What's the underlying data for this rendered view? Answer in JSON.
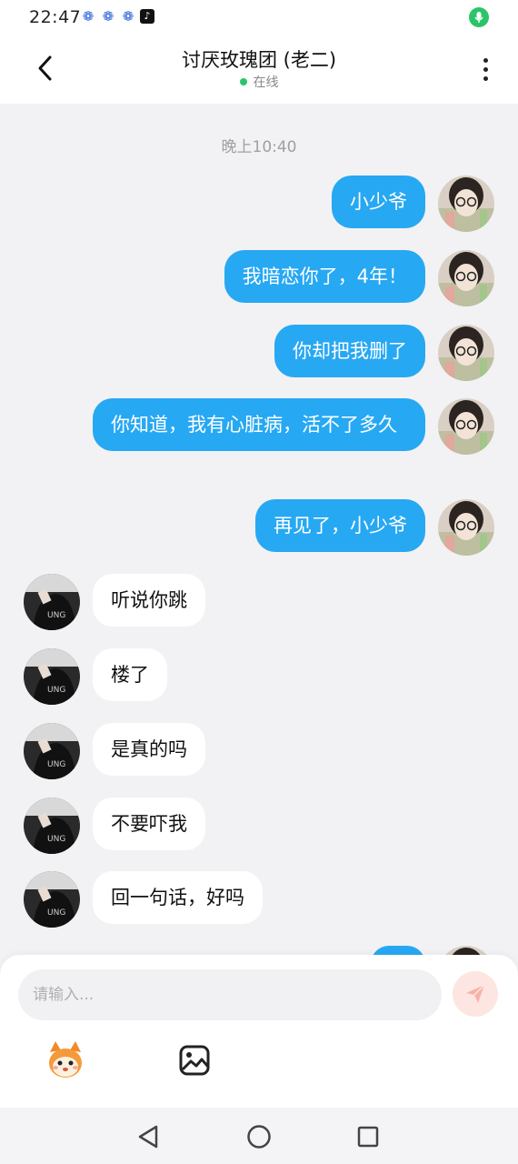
{
  "status_bar": {
    "time": "22:47",
    "icons": [
      "paw-icon",
      "paw-icon",
      "paw-icon",
      "tiktok-icon"
    ],
    "mic_icon": "mic-icon"
  },
  "header": {
    "title": "讨厌玫瑰团 (老二)",
    "status": "在线",
    "back_icon": "chevron-left-icon",
    "more_icon": "more-vertical-icon"
  },
  "chat": {
    "timestamp": "晚上10:40",
    "outgoing": [
      {
        "text": "小少爷"
      },
      {
        "text": "我暗恋你了，4年！"
      },
      {
        "text": "你却把我删了"
      },
      {
        "text": "你知道，我有心脏病，活不了多久"
      },
      {
        "text": "再见了，小少爷"
      }
    ],
    "incoming": [
      {
        "text": "听说你跳"
      },
      {
        "text": "楼了"
      },
      {
        "text": "是真的吗"
      },
      {
        "text": "不要吓我"
      },
      {
        "text": "回一句话，好吗"
      }
    ]
  },
  "composer": {
    "placeholder": "请输入...",
    "send_icon": "send-icon",
    "tools": [
      "mascot-sticker-icon",
      "image-icon"
    ]
  },
  "nav_bar": {
    "buttons": [
      "back-triangle-icon",
      "home-circle-icon",
      "recents-square-icon"
    ]
  },
  "colors": {
    "outgoing_bubble": "#27a8f3",
    "incoming_bubble": "#ffffff",
    "chat_background": "#f2f2f4",
    "online_dot": "#2bc46a"
  }
}
